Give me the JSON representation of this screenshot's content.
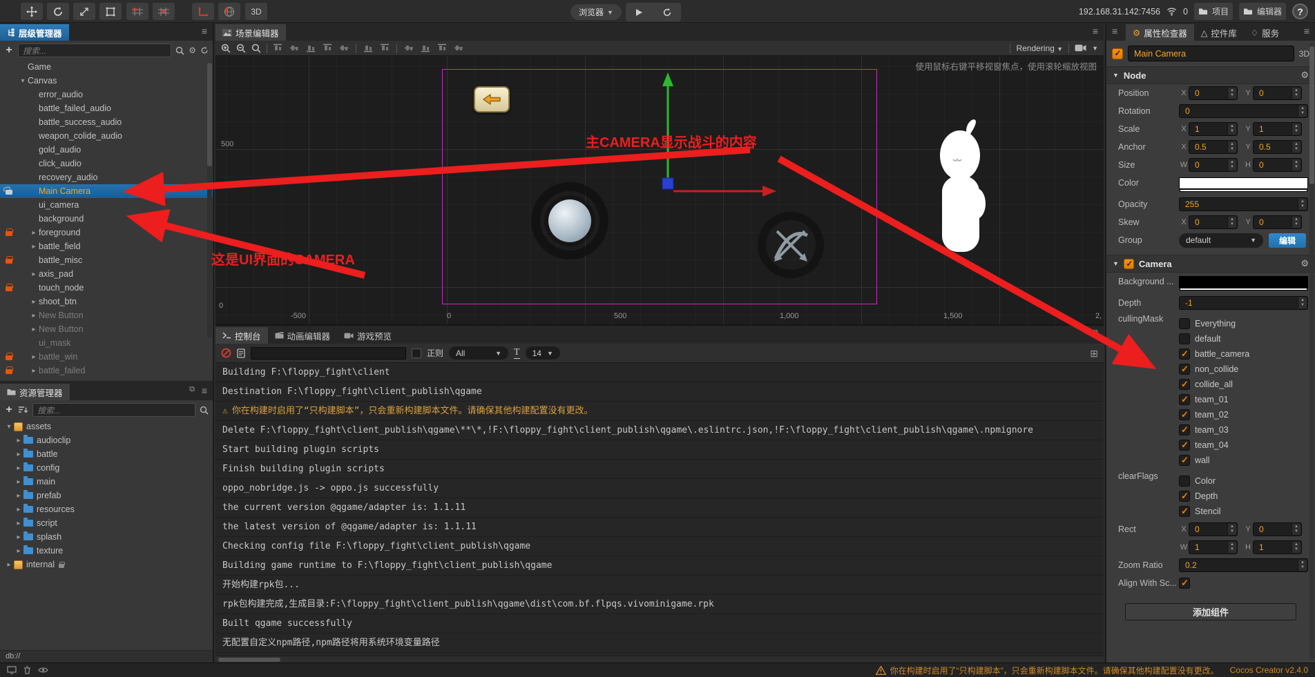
{
  "toolbar": {
    "mode_3d": "3D",
    "browser": "浏览器",
    "ip": "192.168.31.142:7456",
    "device_count": "0",
    "project_btn": "项目",
    "editor_btn": "编辑器",
    "help": "?"
  },
  "hierarchy": {
    "title": "层级管理器",
    "search_placeholder": "搜索...",
    "items": [
      {
        "label": "Game",
        "depth": 1
      },
      {
        "label": "Canvas",
        "depth": 1,
        "arrow": "down"
      },
      {
        "label": "error_audio",
        "depth": 2
      },
      {
        "label": "battle_failed_audio",
        "depth": 2
      },
      {
        "label": "battle_success_audio",
        "depth": 2
      },
      {
        "label": "weapon_colide_audio",
        "depth": 2
      },
      {
        "label": "gold_audio",
        "depth": 2
      },
      {
        "label": "click_audio",
        "depth": 2
      },
      {
        "label": "recovery_audio",
        "depth": 2
      },
      {
        "label": "Main Camera",
        "depth": 2,
        "selected": true,
        "lock": "unlocked"
      },
      {
        "label": "ui_camera",
        "depth": 2
      },
      {
        "label": "background",
        "depth": 2
      },
      {
        "label": "foreground",
        "depth": 2,
        "arrow": "right",
        "lock": "locked"
      },
      {
        "label": "battle_field",
        "depth": 2,
        "arrow": "right"
      },
      {
        "label": "battle_misc",
        "depth": 2,
        "lock": "locked"
      },
      {
        "label": "axis_pad",
        "depth": 2,
        "arrow": "right"
      },
      {
        "label": "touch_node",
        "depth": 2,
        "lock": "locked"
      },
      {
        "label": "shoot_btn",
        "depth": 2,
        "arrow": "right"
      },
      {
        "label": "New Button",
        "depth": 2,
        "arrow": "right",
        "dimmed": true
      },
      {
        "label": "New Button",
        "depth": 2,
        "arrow": "right",
        "dimmed": true
      },
      {
        "label": "ui_mask",
        "depth": 2,
        "dimmed": true
      },
      {
        "label": "battle_win",
        "depth": 2,
        "arrow": "right",
        "lock": "locked",
        "dimmed": true
      },
      {
        "label": "battle_failed",
        "depth": 2,
        "arrow": "right",
        "lock": "locked",
        "dimmed": true
      }
    ]
  },
  "assets": {
    "title": "资源管理器",
    "search_placeholder": "搜索...",
    "db_path": "db://",
    "items": [
      {
        "label": "assets",
        "type": "bundle",
        "arrow": "down",
        "depth": 0
      },
      {
        "label": "audioclip",
        "type": "folder",
        "arrow": "right",
        "depth": 1
      },
      {
        "label": "battle",
        "type": "folder",
        "arrow": "right",
        "depth": 1
      },
      {
        "label": "config",
        "type": "folder",
        "arrow": "right",
        "depth": 1
      },
      {
        "label": "main",
        "type": "folder",
        "arrow": "right",
        "depth": 1
      },
      {
        "label": "prefab",
        "type": "folder",
        "arrow": "right",
        "depth": 1
      },
      {
        "label": "resources",
        "type": "folder",
        "arrow": "right",
        "depth": 1
      },
      {
        "label": "script",
        "type": "folder",
        "arrow": "right",
        "depth": 1
      },
      {
        "label": "splash",
        "type": "folder",
        "arrow": "right",
        "depth": 1
      },
      {
        "label": "texture",
        "type": "folder",
        "arrow": "right",
        "depth": 1
      },
      {
        "label": "internal",
        "type": "bundle",
        "arrow": "right",
        "depth": 0,
        "lock": true
      }
    ]
  },
  "scene": {
    "tab": "场景编辑器",
    "hint": "使用鼠标右键平移视窗焦点，使用滚轮缩放视图",
    "rendering": "Rendering",
    "ruler_left": [
      "500",
      "0"
    ],
    "ruler_bottom": [
      "-500",
      "0",
      "500",
      "1,000",
      "1,500",
      "2,"
    ],
    "annotations": {
      "battle_camera": "主CAMERA显示战斗的内容",
      "ui_camera": "这是UI界面的CAMERA"
    }
  },
  "console": {
    "tabs": [
      "控制台",
      "动画编辑器",
      "游戏预览"
    ],
    "regex_label": "正则",
    "filter_all": "All",
    "font_label": "T",
    "font_size": "14",
    "lines": [
      {
        "type": "log",
        "text": "Building F:\\floppy_fight\\client"
      },
      {
        "type": "log",
        "text": "Destination F:\\floppy_fight\\client_publish\\qgame"
      },
      {
        "type": "warn",
        "text": "你在构建时启用了“只构建脚本”，只会重新构建脚本文件。请确保其他构建配置没有更改。"
      },
      {
        "type": "log",
        "text": "Delete F:\\floppy_fight\\client_publish\\qgame\\**\\*,!F:\\floppy_fight\\client_publish\\qgame\\.eslintrc.json,!F:\\floppy_fight\\client_publish\\qgame\\.npmignore"
      },
      {
        "type": "log",
        "text": "Start building plugin scripts"
      },
      {
        "type": "log",
        "text": "Finish building plugin scripts"
      },
      {
        "type": "log",
        "text": "oppo_nobridge.js -> oppo.js successfully"
      },
      {
        "type": "log",
        "text": "the current version @qgame/adapter is: 1.1.11"
      },
      {
        "type": "log",
        "text": "the latest version of @qgame/adapter is: 1.1.11"
      },
      {
        "type": "log",
        "text": "Checking config file F:\\floppy_fight\\client_publish\\qgame"
      },
      {
        "type": "log",
        "text": "Building game runtime to F:\\floppy_fight\\client_publish\\qgame"
      },
      {
        "type": "log",
        "text": "开始构建rpk包..."
      },
      {
        "type": "log",
        "text": "rpk包构建完成,生成目录:F:\\floppy_fight\\client_publish\\qgame\\dist\\com.bf.flpqs.vivominigame.rpk"
      },
      {
        "type": "log",
        "text": "Built qgame successfully"
      },
      {
        "type": "log",
        "text": "无配置自定义npm路径,npm路径将用系统环境变量路径"
      }
    ]
  },
  "inspector": {
    "tabs": [
      "属性检查器",
      "控件库",
      "服务"
    ],
    "node_name": "Main Camera",
    "mode_3d": "3D",
    "node_section": {
      "title": "Node",
      "position": {
        "label": "Position",
        "x": "0",
        "y": "0"
      },
      "rotation": {
        "label": "Rotation",
        "value": "0"
      },
      "scale": {
        "label": "Scale",
        "x": "1",
        "y": "1"
      },
      "anchor": {
        "label": "Anchor",
        "x": "0.5",
        "y": "0.5"
      },
      "size": {
        "label": "Size",
        "w": "0",
        "h": "0"
      },
      "color": {
        "label": "Color",
        "value": "#FFFFFF"
      },
      "opacity": {
        "label": "Opacity",
        "value": "255"
      },
      "skew": {
        "label": "Skew",
        "x": "0",
        "y": "0"
      },
      "group": {
        "label": "Group",
        "value": "default",
        "edit_label": "编辑"
      }
    },
    "camera_section": {
      "title": "Camera",
      "background": {
        "label": "Background ...",
        "value": "#000000"
      },
      "depth": {
        "label": "Depth",
        "value": "-1"
      },
      "culling_mask": {
        "label": "cullingMask",
        "options": [
          {
            "label": "Everything",
            "checked": false
          },
          {
            "label": "default",
            "checked": false
          },
          {
            "label": "battle_camera",
            "checked": true
          },
          {
            "label": "non_collide",
            "checked": true
          },
          {
            "label": "collide_all",
            "checked": true
          },
          {
            "label": "team_01",
            "checked": true
          },
          {
            "label": "team_02",
            "checked": true
          },
          {
            "label": "team_03",
            "checked": true
          },
          {
            "label": "team_04",
            "checked": true
          },
          {
            "label": "wall",
            "checked": true
          }
        ]
      },
      "clear_flags": {
        "label": "clearFlags",
        "options": [
          {
            "label": "Color",
            "checked": false
          },
          {
            "label": "Depth",
            "checked": true
          },
          {
            "label": "Stencil",
            "checked": true
          }
        ]
      },
      "rect": {
        "label": "Rect",
        "x": "0",
        "y": "0",
        "w": "1",
        "h": "1"
      },
      "zoom_ratio": {
        "label": "Zoom Ratio",
        "value": "0.2"
      },
      "align_with": {
        "label": "Align With Sc...",
        "checked": true
      }
    },
    "add_component_label": "添加组件"
  },
  "statusbar": {
    "warning": "你在构建时启用了“只构建脚本”，只会重新构建脚本文件。请确保其他构建配置没有更改。",
    "version": "Cocos Creator v2.4.0"
  }
}
